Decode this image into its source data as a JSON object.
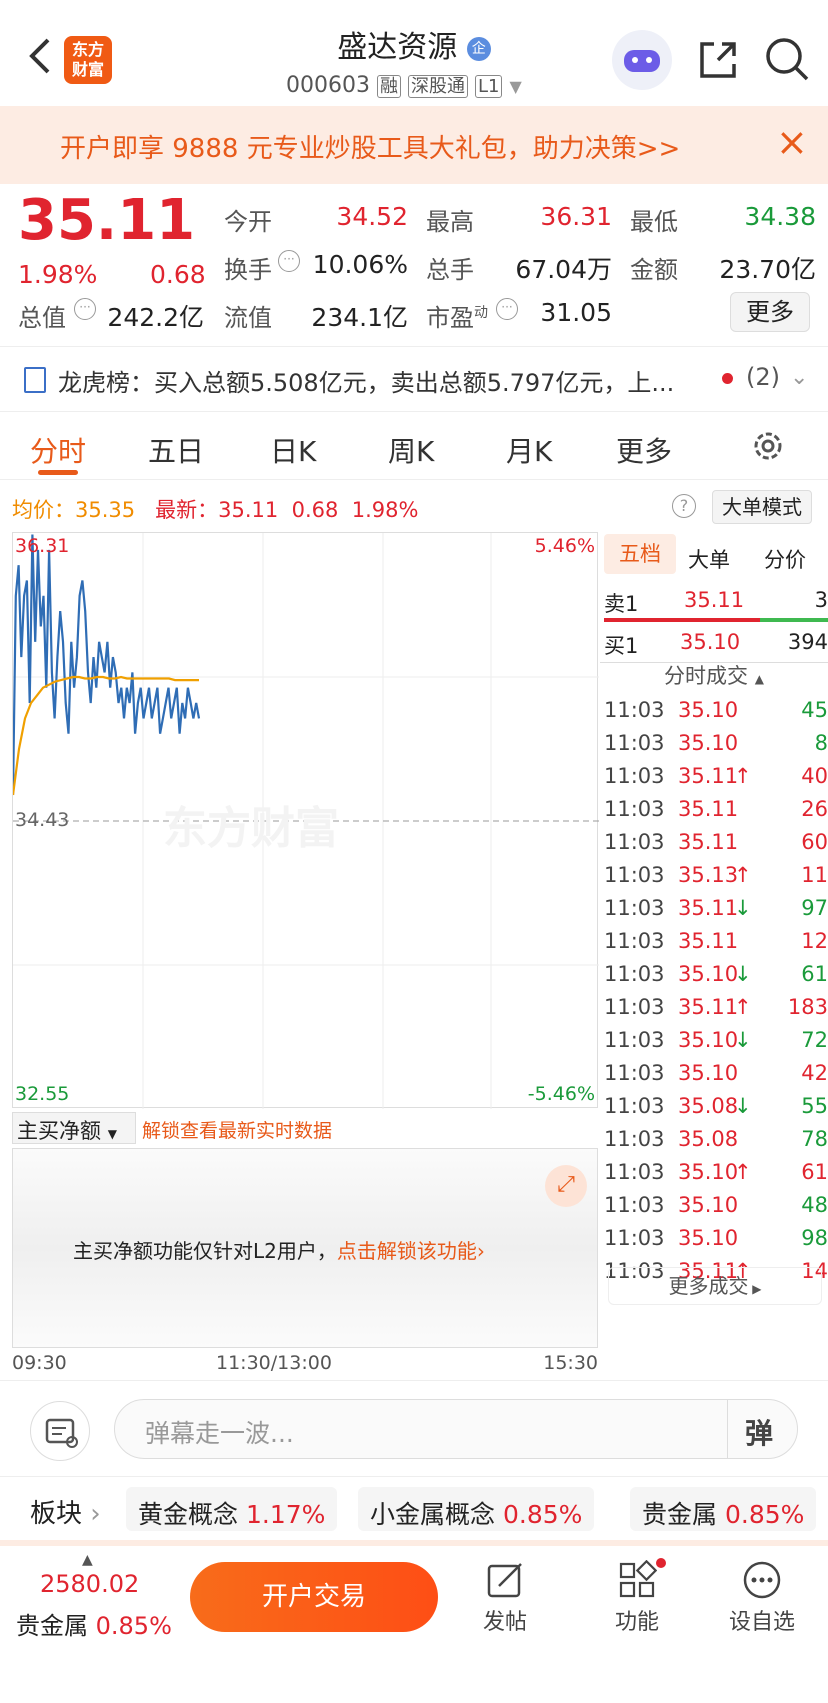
{
  "header": {
    "title": "盛达资源",
    "badge": "企",
    "code": "000603",
    "tags": [
      "融",
      "深股通",
      "L1"
    ],
    "logo_text_1": "东方",
    "logo_text_2": "财富"
  },
  "banner": {
    "text": "开户即享 9888 元专业炒股工具大礼包，助力决策>>",
    "close": "×"
  },
  "quote": {
    "price": "35.11",
    "pct": "1.98%",
    "chg": "0.68",
    "open_label": "今开",
    "open": "34.52",
    "high_label": "最高",
    "high": "36.31",
    "low_label": "最低",
    "low": "34.38",
    "turnover_label": "换手",
    "turnover": "10.06%",
    "volume_label": "总手",
    "volume": "67.04万",
    "amount_label": "金额",
    "amount": "23.70亿",
    "mktcap_label": "总值",
    "mktcap": "242.2亿",
    "float_label": "流值",
    "float": "234.1亿",
    "pe_label": "市盈",
    "pe_sup": "动",
    "pe": "31.05",
    "more": "更多"
  },
  "lhb": {
    "text": "龙虎榜：买入总额5.508亿元，卖出总额5.797亿元，上...",
    "count": "(2)"
  },
  "tabs": [
    "分时",
    "五日",
    "日K",
    "周K",
    "月K",
    "更多"
  ],
  "avgline": {
    "avg_label": "均价：",
    "avg": "35.35",
    "latest_label": "最新：",
    "latest": "35.11",
    "chg": "0.68",
    "pct": "1.98%",
    "mode": "大单模式"
  },
  "chart_data": {
    "type": "line",
    "title": "",
    "y_labels": {
      "top": "36.31",
      "mid": "34.43",
      "bottom": "32.55",
      "top_pct": "5.46%",
      "bottom_pct": "-5.46%"
    },
    "ylim": [
      32.55,
      36.31
    ],
    "x_labels": [
      "09:30",
      "11:30/13:00",
      "15:30"
    ],
    "watermark": "东方财富",
    "series": [
      {
        "name": "price",
        "color": "#2f6db5",
        "values": [
          34.6,
          35.9,
          36.1,
          35.5,
          35.9,
          36.0,
          35.2,
          36.3,
          35.6,
          36.2,
          35.7,
          35.9,
          35.3,
          36.2,
          35.4,
          35.1,
          35.5,
          35.8,
          35.6,
          35.2,
          35.0,
          35.6,
          35.3,
          35.5,
          35.9,
          36.0,
          35.8,
          35.4,
          35.2,
          35.5,
          35.3,
          35.6,
          35.5,
          35.4,
          35.6,
          35.3,
          35.5,
          35.4,
          35.2,
          35.3,
          35.1,
          35.3,
          35.2,
          35.4,
          35.0,
          35.2,
          35.3,
          35.1,
          35.2,
          35.3,
          35.1,
          35.2,
          35.3,
          35.0,
          35.1,
          35.2,
          35.3,
          35.1,
          35.2,
          35.3,
          35.0,
          35.2,
          35.1,
          35.3,
          35.2,
          35.1,
          35.2,
          35.1
        ]
      },
      {
        "name": "avg",
        "color": "#f0a000",
        "values": [
          34.6,
          34.9,
          35.1,
          35.2,
          35.25,
          35.3,
          35.32,
          35.34,
          35.35,
          35.36,
          35.37,
          35.37,
          35.36,
          35.36,
          35.37,
          35.37,
          35.36,
          35.36,
          35.37,
          35.36,
          35.36,
          35.36,
          35.36,
          35.36,
          35.36,
          35.36,
          35.36,
          35.35,
          35.35,
          35.35,
          35.35,
          35.35
        ]
      }
    ]
  },
  "mainbuy": {
    "dropdown": "主买净额",
    "unlock": "解锁查看最新实时数据",
    "notice": "主买净额功能仅针对L2用户，",
    "notice_link": "点击解锁该功能"
  },
  "book": {
    "tabs": [
      "五档",
      "大单",
      "分价"
    ],
    "sell1_label": "卖1",
    "sell1_price": "35.11",
    "sell1_vol": "3",
    "buy1_label": "买1",
    "buy1_price": "35.10",
    "buy1_vol": "394",
    "trades_title": "分时成交",
    "trades": [
      {
        "time": "11:03",
        "price": "35.10",
        "arrow": "",
        "vol": "45",
        "vc": "green"
      },
      {
        "time": "11:03",
        "price": "35.10",
        "arrow": "",
        "vol": "8",
        "vc": "green"
      },
      {
        "time": "11:03",
        "price": "35.11",
        "arrow": "↑",
        "vol": "40",
        "vc": "red"
      },
      {
        "time": "11:03",
        "price": "35.11",
        "arrow": "",
        "vol": "26",
        "vc": "red"
      },
      {
        "time": "11:03",
        "price": "35.11",
        "arrow": "",
        "vol": "60",
        "vc": "red"
      },
      {
        "time": "11:03",
        "price": "35.13",
        "arrow": "↑",
        "vol": "11",
        "vc": "red"
      },
      {
        "time": "11:03",
        "price": "35.11",
        "arrow": "↓",
        "vol": "97",
        "vc": "green"
      },
      {
        "time": "11:03",
        "price": "35.11",
        "arrow": "",
        "vol": "12",
        "vc": "red"
      },
      {
        "time": "11:03",
        "price": "35.10",
        "arrow": "↓",
        "vol": "61",
        "vc": "green"
      },
      {
        "time": "11:03",
        "price": "35.11",
        "arrow": "↑",
        "vol": "183",
        "vc": "red"
      },
      {
        "time": "11:03",
        "price": "35.10",
        "arrow": "↓",
        "vol": "72",
        "vc": "green"
      },
      {
        "time": "11:03",
        "price": "35.10",
        "arrow": "",
        "vol": "42",
        "vc": "red"
      },
      {
        "time": "11:03",
        "price": "35.08",
        "arrow": "↓",
        "vol": "55",
        "vc": "green"
      },
      {
        "time": "11:03",
        "price": "35.08",
        "arrow": "",
        "vol": "78",
        "vc": "green"
      },
      {
        "time": "11:03",
        "price": "35.10",
        "arrow": "↑",
        "vol": "61",
        "vc": "red"
      },
      {
        "time": "11:03",
        "price": "35.10",
        "arrow": "",
        "vol": "48",
        "vc": "green"
      },
      {
        "time": "11:03",
        "price": "35.10",
        "arrow": "",
        "vol": "98",
        "vc": "green"
      },
      {
        "time": "11:03",
        "price": "35.11",
        "arrow": "↑",
        "vol": "14",
        "vc": "red"
      }
    ],
    "more": "更多成交"
  },
  "comment": {
    "placeholder": "弹幕走一波...",
    "danmu": "弹"
  },
  "sectors": {
    "label": "板块",
    "items": [
      {
        "name": "黄金概念",
        "pct": "1.17%"
      },
      {
        "name": "小金属概念",
        "pct": "0.85%"
      },
      {
        "name": "贵金属",
        "pct": "0.85%"
      }
    ]
  },
  "bottom": {
    "index_value": "2580.02",
    "index_name": "贵金属",
    "index_pct": "0.85%",
    "trade": "开户交易",
    "post": "发帖",
    "func": "功能",
    "watch": "设自选"
  }
}
